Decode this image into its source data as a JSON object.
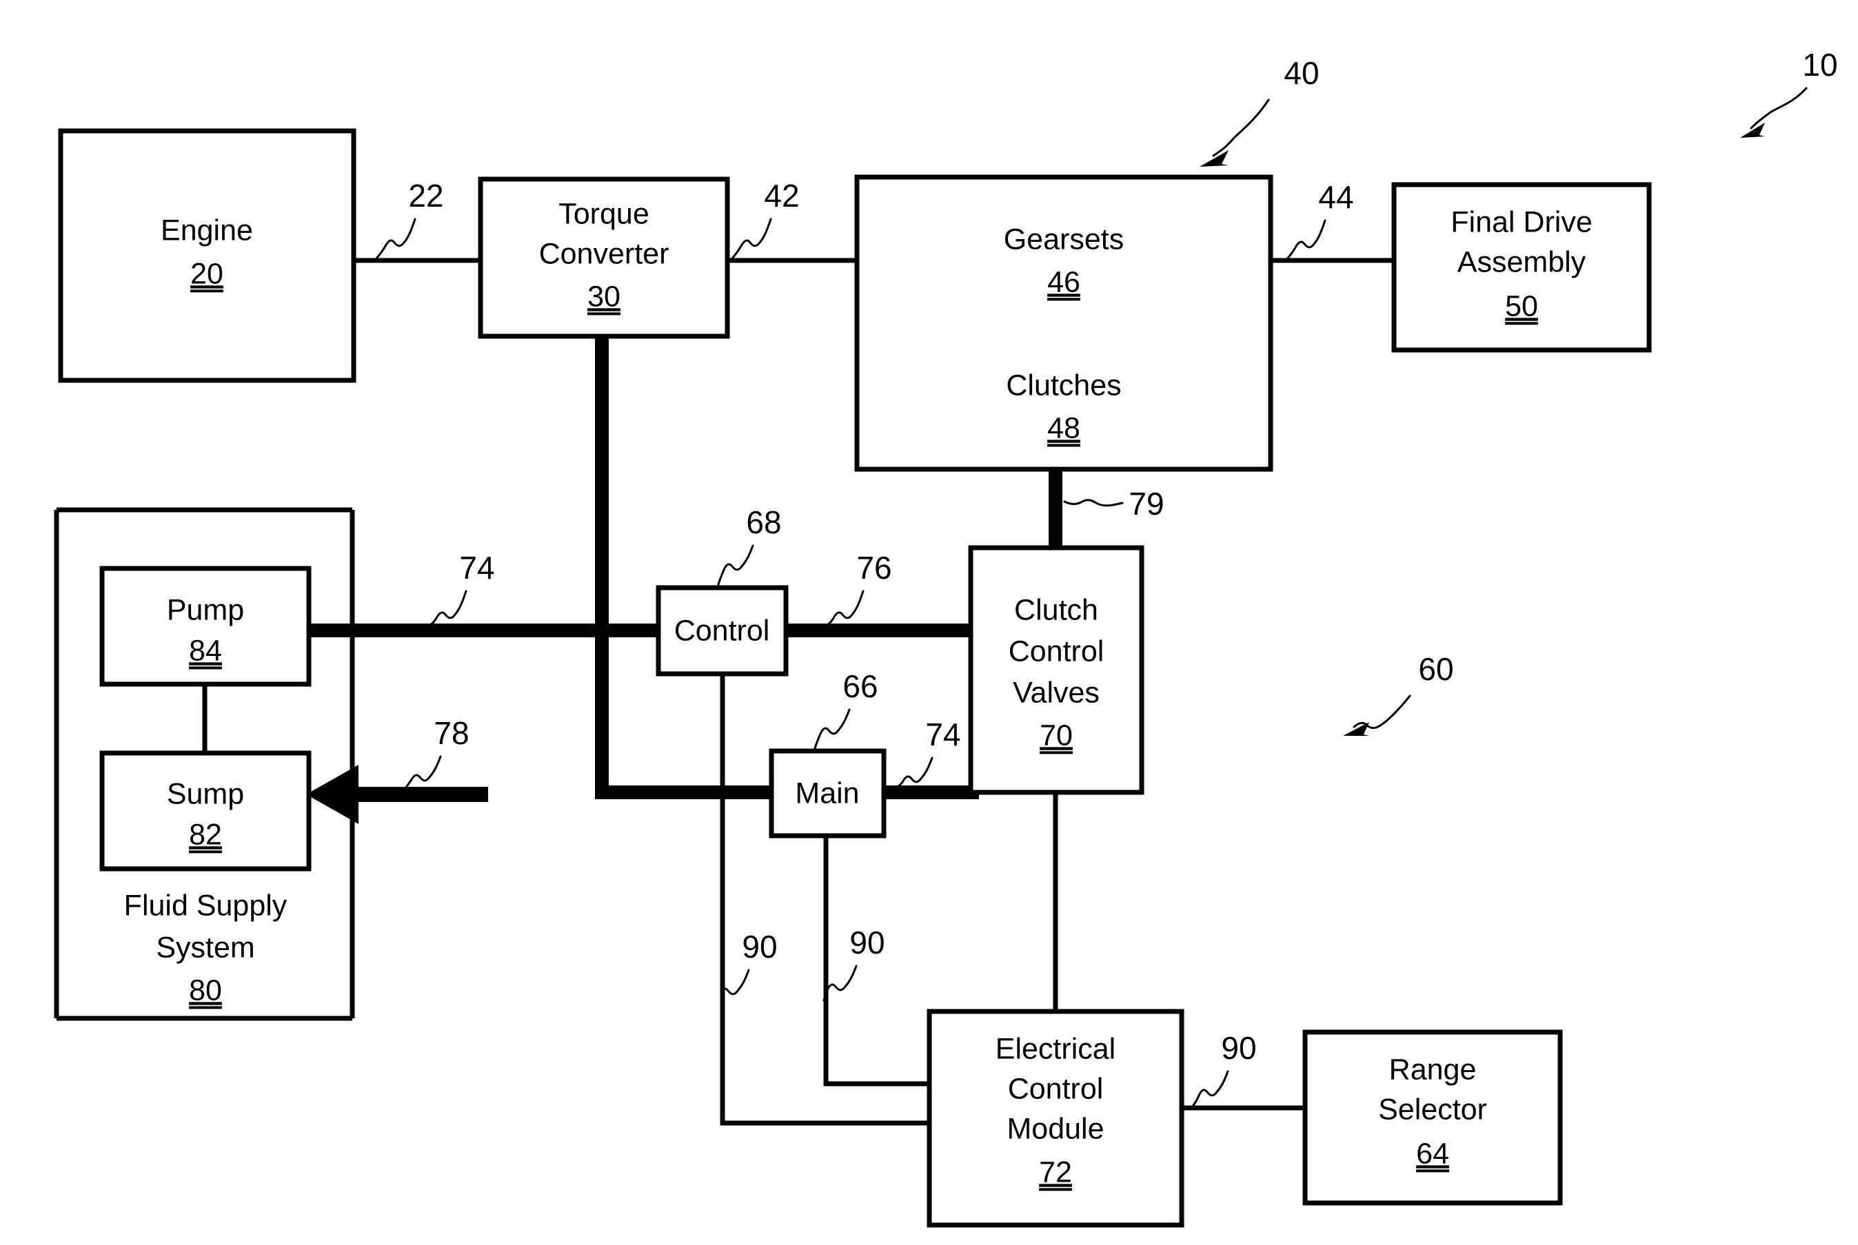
{
  "figure": {
    "title": "Vehicle powertrain / transmission control block diagram",
    "background_color": "#ffffff",
    "line_color": "#000000"
  },
  "blocks": {
    "engine": {
      "label": "Engine",
      "number": "20"
    },
    "torque_converter": {
      "label_line1": "Torque",
      "label_line2": "Converter",
      "number": "30"
    },
    "gearsets": {
      "label": "Gearsets",
      "number": "46"
    },
    "clutches": {
      "label": "Clutches",
      "number": "48"
    },
    "final_drive": {
      "label_line1": "Final Drive",
      "label_line2": "Assembly",
      "number": "50"
    },
    "pump": {
      "label": "Pump",
      "number": "84"
    },
    "sump": {
      "label": "Sump",
      "number": "82"
    },
    "fluid_supply": {
      "label_line1": "Fluid Supply",
      "label_line2": "System",
      "number": "80"
    },
    "control": {
      "label": "Control"
    },
    "main": {
      "label": "Main"
    },
    "clutch_control_valves": {
      "label_line1": "Clutch",
      "label_line2": "Control",
      "label_line3": "Valves",
      "number": "70"
    },
    "ecm": {
      "label_line1": "Electrical",
      "label_line2": "Control",
      "label_line3": "Module",
      "number": "72"
    },
    "range_selector": {
      "label_line1": "Range",
      "label_line2": "Selector",
      "number": "64"
    }
  },
  "reference_numerals": {
    "assembly_10": "10",
    "transmission_40": "40",
    "control_system_60": "60",
    "engine_to_tc_22": "22",
    "tc_to_gearsets_42": "42",
    "gearsets_to_final_drive_44": "44",
    "clutches_to_valves_79": "79",
    "pump_supply_74_left": "74",
    "control_to_valves_76": "76",
    "main_to_valves_74_right": "74",
    "return_to_sump_78": "78",
    "control_valve_68": "68",
    "main_valve_66": "66",
    "signal_90_left": "90",
    "signal_90_mid": "90",
    "signal_90_right": "90"
  }
}
